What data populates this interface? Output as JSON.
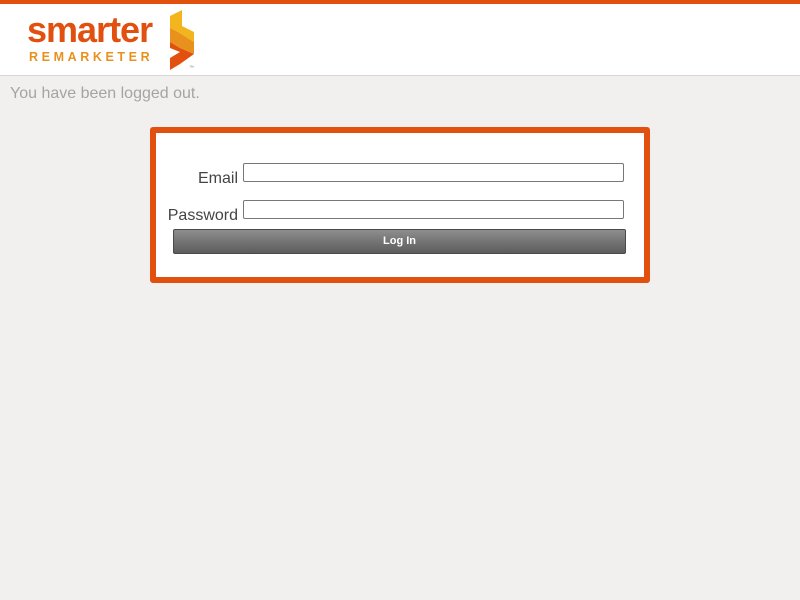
{
  "brand": {
    "name": "smarter",
    "sub": "REMARKETER",
    "trademark": "™",
    "primary_color": "#e2500f",
    "secondary_color": "#e8911c",
    "mark_icon": "s-bolt-icon"
  },
  "message": {
    "logged_out": "You have been logged out."
  },
  "login": {
    "email_label": "Email",
    "email_value": "",
    "password_label": "Password",
    "password_value": "",
    "submit_label": "Log In"
  }
}
